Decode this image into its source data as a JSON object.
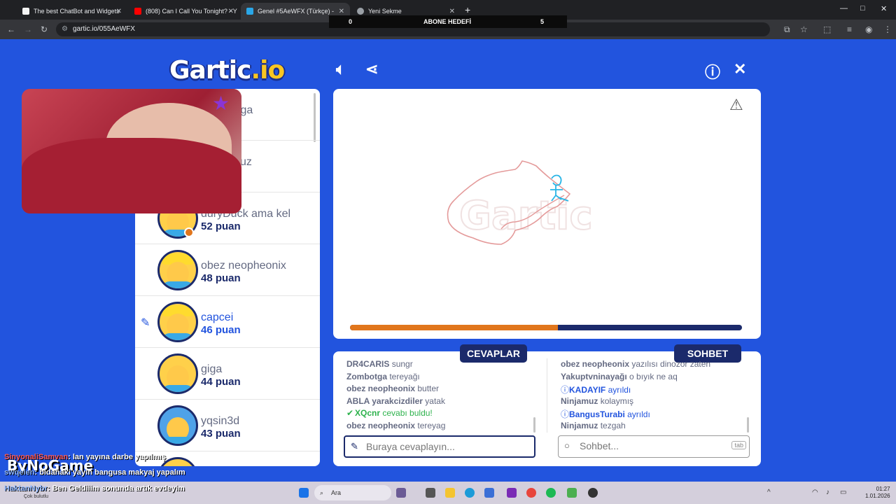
{
  "browser": {
    "tabs": [
      {
        "title": "The best ChatBot and Widgets",
        "favicon_color": "#f4f4f4",
        "active": false
      },
      {
        "title": "(808) Can I Call You Tonight? - Y",
        "favicon_color": "#ff0000",
        "active": false
      },
      {
        "title": "Genel #5AeWFX (Türkçe) -",
        "favicon_color": "#2aa7e8",
        "active": true
      },
      {
        "title": "Yeni Sekme",
        "favicon_color": "#9aa0a6",
        "active": false
      }
    ],
    "url": "gartic.io/055AeWFX"
  },
  "overlay_goal": {
    "left_value": "0",
    "label": "ABONE HEDEFİ",
    "right_value": "5"
  },
  "logo": {
    "main": "Gartic",
    "suffix": ".io"
  },
  "players": [
    {
      "name": "tga",
      "score": "",
      "active": false,
      "drawing": false
    },
    {
      "name": "uz",
      "score": "",
      "active": false,
      "drawing": false
    },
    {
      "name": "duryDuck ama kel",
      "score": "52 puan",
      "active": false,
      "drawing": false
    },
    {
      "name": "obez neopheonix",
      "score": "48 puan",
      "active": false,
      "drawing": false
    },
    {
      "name": "capcei",
      "score": "46 puan",
      "active": true,
      "drawing": true
    },
    {
      "name": "giga",
      "score": "44 puan",
      "active": false,
      "drawing": false
    },
    {
      "name": "yqsin3d",
      "score": "43 puan",
      "active": false,
      "drawing": false
    }
  ],
  "round_progress": 0.53,
  "answers": {
    "label": "CEVAPLAR",
    "messages": [
      {
        "user": "DR4CARIS",
        "text": "sungr",
        "type": "normal"
      },
      {
        "user": "Zombotga",
        "text": "tereyağı",
        "type": "normal"
      },
      {
        "user": "obez neopheonix",
        "text": "butter",
        "type": "normal"
      },
      {
        "user": "ABLA yarakcizdiler",
        "text": "yatak",
        "type": "normal"
      },
      {
        "user": "XQcnr",
        "text": "cevabı buldu!",
        "type": "correct"
      },
      {
        "user": "obez neopheonix",
        "text": "tereyag",
        "type": "normal"
      }
    ],
    "input_placeholder": "Buraya cevaplayın..."
  },
  "chat": {
    "label": "SOHBET",
    "messages": [
      {
        "user": "obez neopheonix",
        "text": "yazılısı dinozor zaten",
        "type": "normal"
      },
      {
        "user": "Yakuptvninayağı",
        "text": "o bıyık ne aq",
        "type": "normal"
      },
      {
        "user": "KADAYIF",
        "text": "ayrıldı",
        "type": "info"
      },
      {
        "user": "Ninjamuz",
        "text": "kolaymış",
        "type": "normal"
      },
      {
        "user": "BangusTurabi",
        "text": "ayrıldı",
        "type": "info"
      },
      {
        "user": "Ninjamuz",
        "text": "tezgah",
        "type": "normal"
      }
    ],
    "input_placeholder": "Sohbet...",
    "tab_hint": "tab"
  },
  "stream_chat": [
    {
      "user": "SinyonaliSamvan",
      "text": ": lan yayına darbe yapılmış"
    },
    {
      "user": "swqelen",
      "text": ": bidahaki yayın bangusa makyaj yapalım"
    },
    {
      "user": "HaktanNybr",
      "text": ": Ben Geldiiim sonunda artık evdeyim"
    }
  ],
  "stream_brand": "ByNoGame",
  "taskbar": {
    "search": "Ara",
    "time": "01:27",
    "date": "1.01.2026",
    "weather": "Çok bulutlu"
  }
}
